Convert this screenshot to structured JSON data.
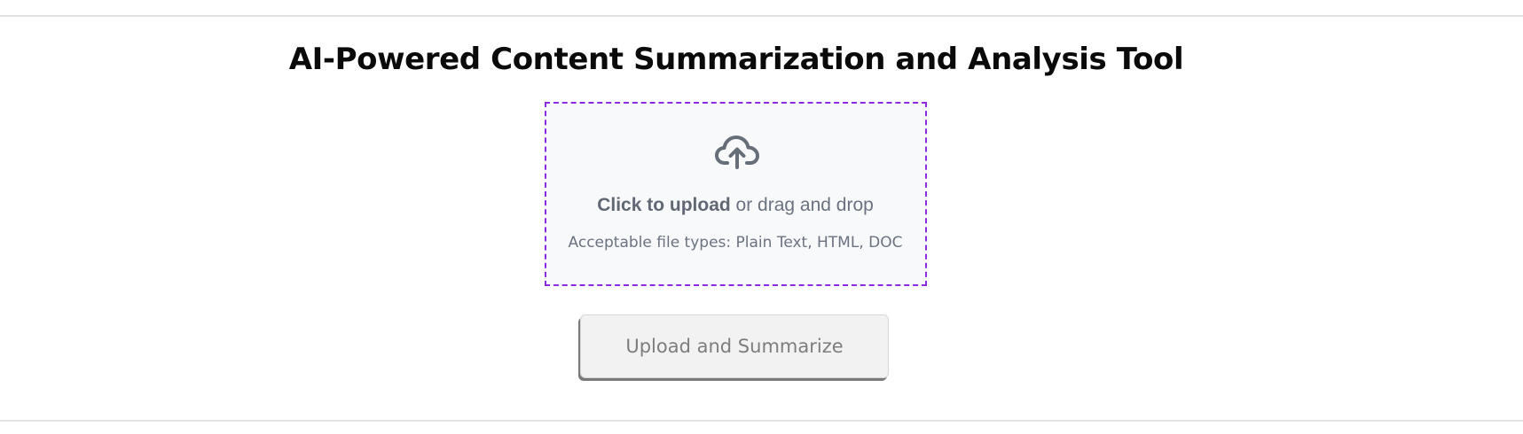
{
  "header": {
    "title": "AI-Powered Content Summarization and Analysis Tool"
  },
  "upload": {
    "icon": "cloud-upload-icon",
    "cta_strong": "Click to upload",
    "cta_rest": " or drag and drop",
    "file_types": "Acceptable file types: Plain Text, HTML, DOC",
    "border_color": "#8a2be2"
  },
  "actions": {
    "submit_label": "Upload and Summarize"
  }
}
